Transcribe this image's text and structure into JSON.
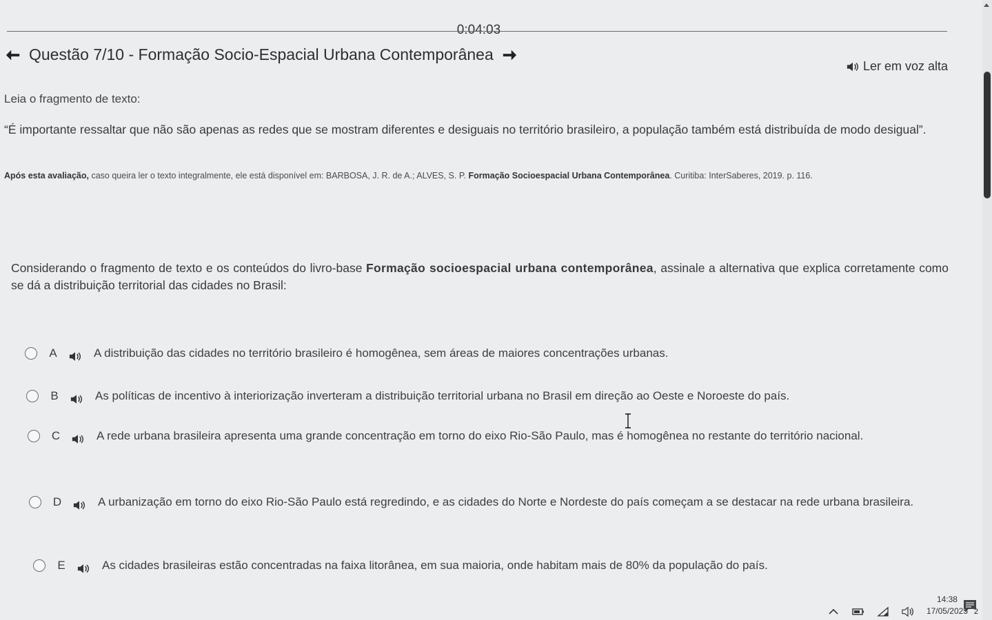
{
  "timer": "0:04:03",
  "header": {
    "title": "Questão 7/10 - Formação Socio-Espacial Urbana Contemporânea"
  },
  "read_aloud": {
    "label": "Ler em voz alta"
  },
  "intro": "Leia o fragmento de texto:",
  "quote": "“É importante ressaltar que não são apenas as redes que se mostram diferentes e desiguais no território brasileiro, a população também está distribuída de modo desigual”.",
  "source": {
    "lead": "Após esta avaliação,",
    "middle": " caso queira ler o texto integralmente, ele está disponível em: BARBOSA, J. R. de A.; ALVES, S. P. ",
    "book": "Formação Socioespacial Urbana Contemporânea",
    "tail": ". Curitiba: InterSaberes, 2019. p. 116."
  },
  "question": {
    "before": "Considerando o fragmento de texto e os conteúdos do livro-base ",
    "book": "Formação socioespacial urbana contemporânea",
    "after": ", assinale a alternativa que explica corretamente como se dá a distribuição territorial das cidades no Brasil:"
  },
  "options": [
    {
      "letter": "A",
      "text": "A distribuição das cidades no território brasileiro é homogênea, sem áreas de maiores concentrações urbanas."
    },
    {
      "letter": "B",
      "text": "As políticas de incentivo à interiorização inverteram a distribuição territorial urbana no Brasil em direção ao Oeste e Noroeste do país."
    },
    {
      "letter": "C",
      "text": "A rede urbana brasileira apresenta uma grande concentração em torno do eixo Rio-São Paulo, mas é homogênea no restante do território nacional."
    },
    {
      "letter": "D",
      "text": "A urbanização em torno do eixo Rio-São Paulo está regredindo, e as cidades do Norte e Nordeste do país começam a se destacar na rede urbana brasileira."
    },
    {
      "letter": "E",
      "text": "As cidades brasileiras estão concentradas na faixa litorânea, em sua maioria, onde habitam mais de 80% da população do país."
    }
  ],
  "taskbar": {
    "time": "14:38",
    "date": "17/05/2025",
    "notification_count": "2"
  }
}
